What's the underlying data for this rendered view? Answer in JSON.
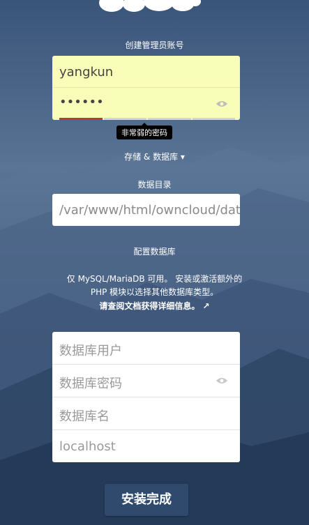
{
  "admin": {
    "heading": "创建管理员账号",
    "username_value": "yangkun",
    "password_value": "••••••",
    "strength_tooltip": "非常弱的密码"
  },
  "storage": {
    "toggle_label": "存储 & 数据库 ▾",
    "data_dir_heading": "数据目录",
    "data_dir_value": "/var/www/html/owncloud/data"
  },
  "database": {
    "heading": "配置数据库",
    "note_line1": "仅 MySQL/MariaDB 可用。 安装或激活额外的",
    "note_line2": "PHP 模块以选择其他数据库类型。",
    "docs_link": "请查阅文档获得详细信息。 ↗",
    "user_placeholder": "数据库用户",
    "password_placeholder": "数据库密码",
    "name_placeholder": "数据库名",
    "host_placeholder": "localhost"
  },
  "install_button": "安装完成",
  "icons": [
    "owncloud-logo",
    "eye-icon",
    "external-link-icon",
    "caret-down-icon"
  ]
}
